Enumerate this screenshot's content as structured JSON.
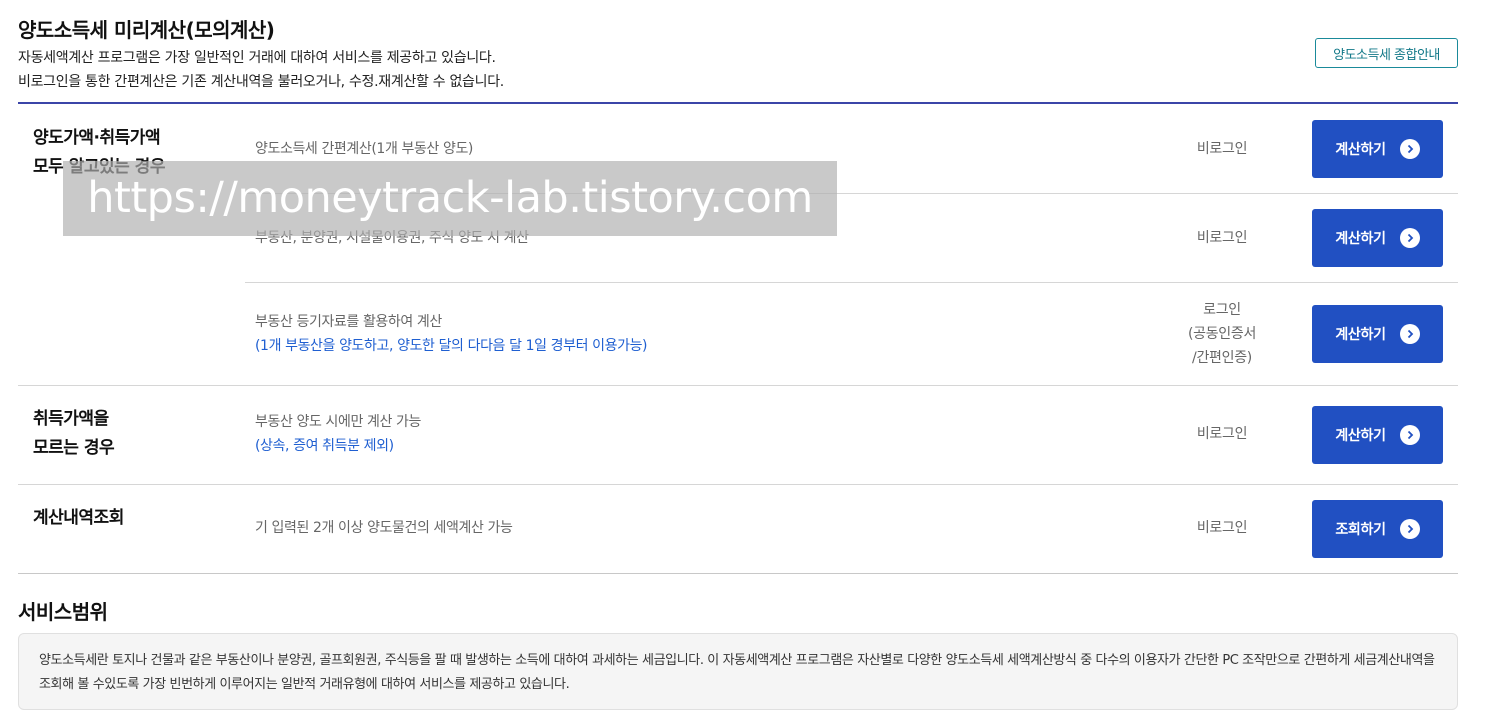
{
  "header": {
    "title": "양도소득세 미리계산(모의계산)",
    "intro_line1": "자동세액계산 프로그램은 가장 일반적인 거래에 대하여 서비스를 제공하고 있습니다.",
    "intro_line2": "비로그인을 통한 간편계산은 기존 계산내역을 불러오거나, 수정.재계산할 수 없습니다.",
    "guide_button": "양도소득세 종합안내"
  },
  "categories": [
    {
      "title_line1": "양도가액·취득가액",
      "title_line2": "모두 알고있는 경우"
    },
    {
      "title_line1": "취득가액을",
      "title_line2": "모르는 경우"
    },
    {
      "title_line1": "계산내역조회"
    }
  ],
  "rows": [
    {
      "desc": "양도소득세 간편계산(1개 부동산 양도)",
      "status": "비로그인",
      "button": "계산하기"
    },
    {
      "desc": "부동산, 분양권, 시설물이용권, 주식 양도 시 계산",
      "status": "비로그인",
      "button": "계산하기"
    },
    {
      "desc": "부동산 등기자료를 활용하여 계산",
      "desc_note": "(1개 부동산을 양도하고, 양도한 달의 다다음 달 1일 경부터 이용가능)",
      "status_line1": "로그인",
      "status_line2": "(공동인증서",
      "status_line3": "/간편인증)",
      "button": "계산하기"
    },
    {
      "desc": "부동산 양도 시에만 계산 가능",
      "desc_note": "(상속, 증여 취득분 제외)",
      "status": "비로그인",
      "button": "계산하기"
    },
    {
      "desc": "기 입력된 2개 이상 양도물건의 세액계산 가능",
      "status": "비로그인",
      "button": "조회하기"
    }
  ],
  "watermark": "https://moneytrack-lab.tistory.com",
  "service_scope": {
    "title": "서비스범위",
    "text": "양도소득세란 토지나 건물과 같은 부동산이나 분양권, 골프회원권, 주식등을 팔 때 발생하는 소득에 대하여 과세하는 세금입니다. 이 자동세액계산 프로그램은 자산별로 다양한 양도소득세 세액계산방식 중 다수의 이용자가 간단한 PC 조작만으로 간편하게 세금계산내역을 조회해 볼 수있도록 가장 빈번하게 이루어지는 일반적 거래유형에 대하여 서비스를 제공하고 있습니다."
  },
  "icons": {
    "button_arrow": "chevron-right-circle-icon"
  },
  "colors": {
    "accent": "#2150c2",
    "rule": "#3b45a8",
    "note": "#1f5fd1",
    "guide": "#127888"
  }
}
